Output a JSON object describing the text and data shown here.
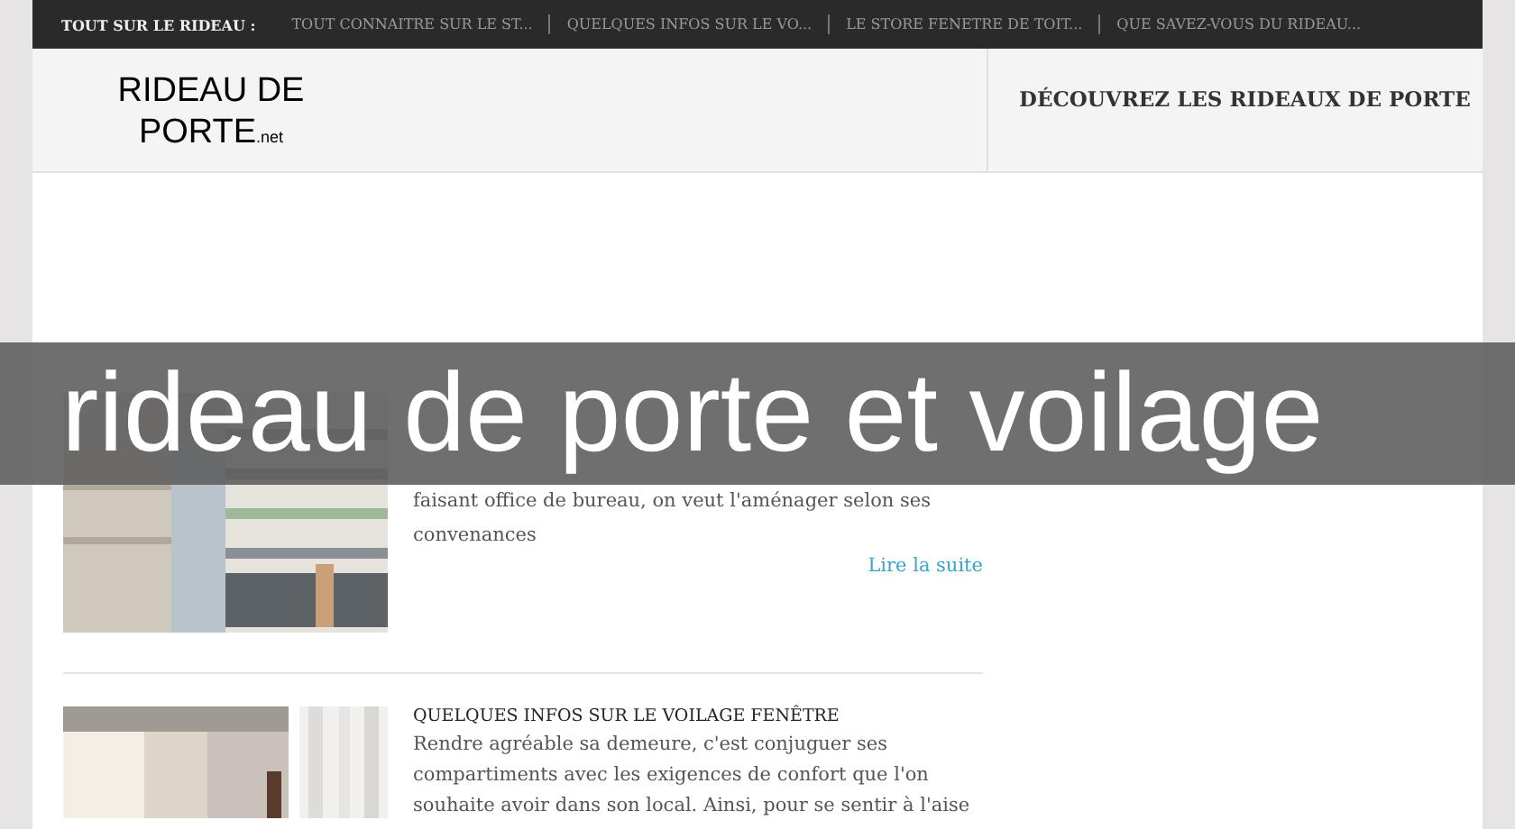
{
  "nav": {
    "label": "TOUT SUR LE RIDEAU :",
    "links": [
      "TOUT CONNAITRE SUR LE ST...",
      "QUELQUES INFOS SUR LE VO...",
      "LE STORE FENETRE DE TOIT...",
      "QUE SAVEZ-VOUS DU RIDEAU..."
    ]
  },
  "header": {
    "logo": "RIDEAU DE",
    "logo_line2": "PORTE",
    "logo_suffix": ".net",
    "tagline": "DÉCOUVREZ LES RIDEAUX DE PORTE"
  },
  "articles": [
    {
      "text": "faisant office de bureau, on veut l'aménager selon ses convenances",
      "more": "Lire la suite"
    },
    {
      "title": "QUELQUES INFOS SUR LE VOILAGE FENÊTRE",
      "text": "Rendre agréable sa demeure, c'est conjuguer ses compartiments avec les exigences de confort que l'on souhaite avoir dans son local. Ainsi, pour se sentir à l'aise"
    }
  ],
  "banner": {
    "title": "rideau de porte et voilage"
  }
}
